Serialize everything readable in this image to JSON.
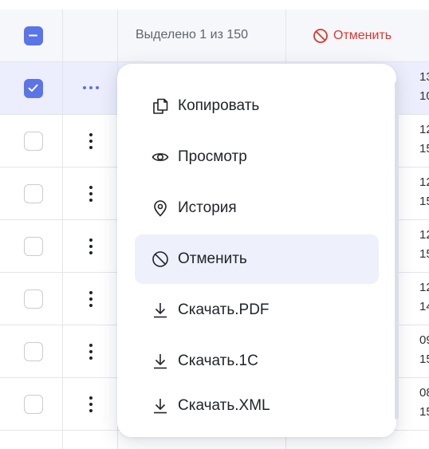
{
  "header": {
    "selected_text": "Выделено 1 из 150",
    "cancel_label": "Отменить"
  },
  "rows": [
    {
      "c1": "13",
      "c2": "10",
      "selected": true
    },
    {
      "c1": "12",
      "c2": "15",
      "selected": false
    },
    {
      "c1": "12",
      "c2": "15",
      "selected": false
    },
    {
      "c1": "12",
      "c2": "15",
      "selected": false
    },
    {
      "c1": "12",
      "c2": "14",
      "selected": false
    },
    {
      "c1": "09",
      "c2": "15",
      "selected": false
    },
    {
      "c1": "08",
      "c2": "15",
      "selected": false
    }
  ],
  "menu": {
    "items": [
      {
        "label": "Копировать",
        "icon": "copy-icon"
      },
      {
        "label": "Просмотр",
        "icon": "eye-icon"
      },
      {
        "label": "История",
        "icon": "location-pin-icon"
      },
      {
        "label": "Отменить",
        "icon": "cancel-circle-icon",
        "active": true
      },
      {
        "label": "Скачать.PDF",
        "icon": "download-icon"
      },
      {
        "label": "Скачать.1С",
        "icon": "download-icon"
      },
      {
        "label": "Скачать.XML",
        "icon": "download-icon"
      }
    ]
  },
  "colors": {
    "accent": "#5b74e8",
    "danger": "#e0352b",
    "selected_row": "#eceefd",
    "active_item": "#eef0fb"
  }
}
